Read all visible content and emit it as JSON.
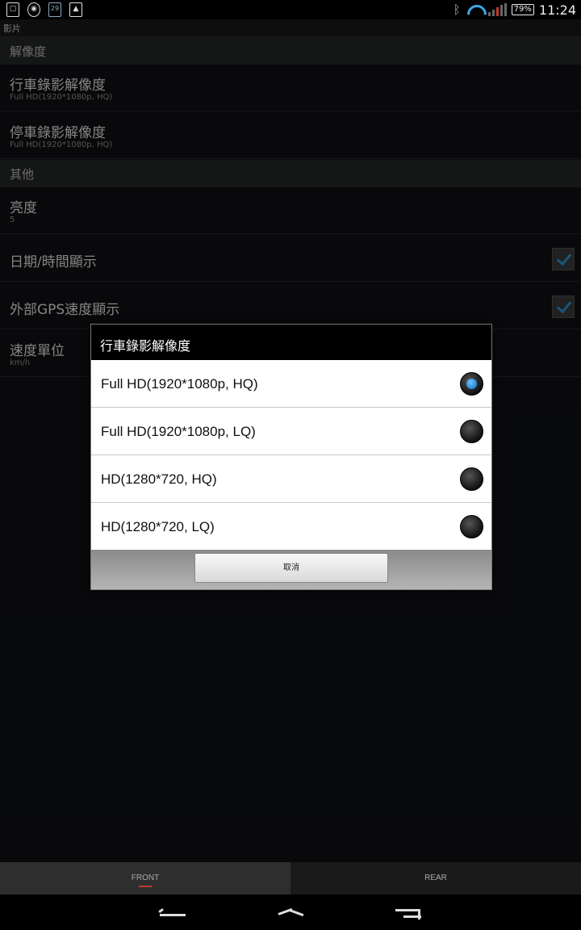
{
  "status_bar": {
    "calendar_day": "29",
    "battery": "79%",
    "time": "11:24",
    "icons": [
      "sim-icon",
      "sync-icon",
      "calendar-icon",
      "gallery-icon",
      "bluetooth-icon",
      "wifi-icon",
      "signal-icon",
      "battery-icon"
    ]
  },
  "app_bar": {
    "title": "影片"
  },
  "sections": {
    "resolution": {
      "header": "解像度",
      "driving": {
        "title": "行車錄影解像度",
        "summary": "Full HD(1920*1080p, HQ)"
      },
      "parking": {
        "title": "停車錄影解像度",
        "summary": "Full HD(1920*1080p, HQ)"
      }
    },
    "other": {
      "header": "其他",
      "brightness": {
        "title": "亮度",
        "summary": "5"
      },
      "datetime": {
        "title": "日期/時間顯示",
        "checked": true
      },
      "gps_speed": {
        "title": "外部GPS速度顯示",
        "checked": true
      },
      "speed_unit": {
        "title": "速度單位",
        "summary": "km/h"
      }
    }
  },
  "dialog": {
    "title": "行車錄影解像度",
    "options": [
      {
        "label": "Full HD(1920*1080p, HQ)",
        "selected": true
      },
      {
        "label": "Full HD(1920*1080p, LQ)",
        "selected": false
      },
      {
        "label": "HD(1280*720, HQ)",
        "selected": false
      },
      {
        "label": "HD(1280*720, LQ)",
        "selected": false
      }
    ],
    "cancel_label": "取消"
  },
  "tabs": {
    "front": "FRONT",
    "rear": "REAR",
    "active": "front"
  },
  "colors": {
    "accent": "#2f9be0",
    "tab_indicator": "#c0392b"
  }
}
